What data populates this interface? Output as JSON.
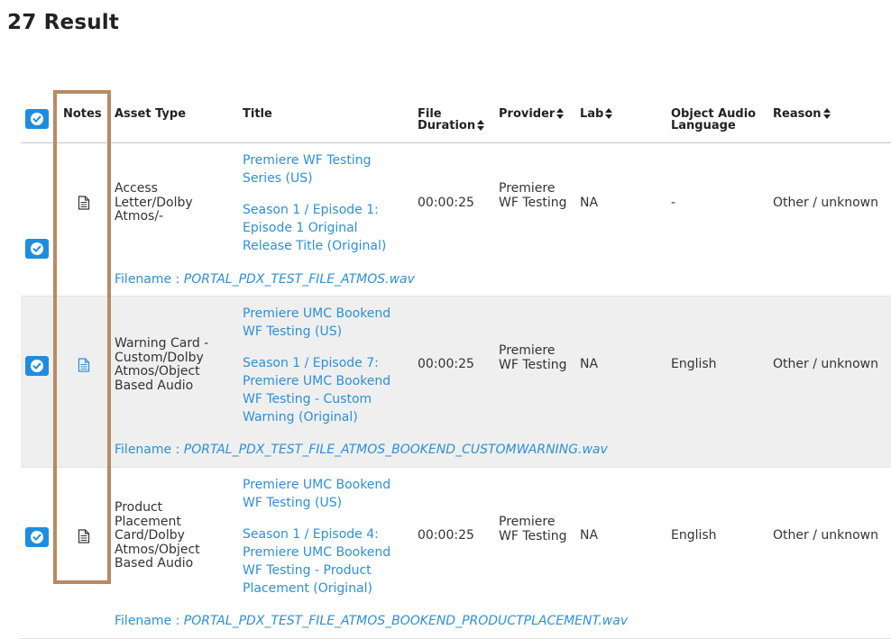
{
  "page": {
    "result_title": "27 Result"
  },
  "header": {
    "notes": "Notes",
    "asset_type": "Asset Type",
    "title": "Title",
    "file_duration_line1": "File",
    "file_duration_line2": "Duration",
    "provider": "Provider",
    "lab": "Lab",
    "object_audio_language_line1": "Object Audio",
    "object_audio_language_line2": "Language",
    "reason": "Reason"
  },
  "rows": [
    {
      "asset_type": "Access Letter/Dolby Atmos/-",
      "series_title": "Premiere WF Testing Series (US)",
      "episode_title": "Season 1 / Episode 1: Episode 1 Original Release Title (Original)",
      "duration": "00:00:25",
      "provider": "Premiere WF Testing",
      "lab": "NA",
      "object_audio_language": "-",
      "reason": "Other / unknown",
      "filename_label": "Filename :",
      "filename": "PORTAL_PDX_TEST_FILE_ATMOS.wav",
      "note_icon_color": "#333333"
    },
    {
      "asset_type": "Warning Card - Custom/Dolby Atmos/Object Based Audio",
      "series_title": "Premiere UMC Bookend WF Testing (US)",
      "episode_title": "Season 1 / Episode 7: Premiere UMC Bookend WF Testing - Custom Warning (Original)",
      "duration": "00:00:25",
      "provider": "Premiere WF Testing",
      "lab": "NA",
      "object_audio_language": "English",
      "reason": "Other / unknown",
      "filename_label": "Filename :",
      "filename": "PORTAL_PDX_TEST_FILE_ATMOS_BOOKEND_CUSTOMWARNING.wav",
      "note_icon_color": "#2f8fd6"
    },
    {
      "asset_type": "Product Placement Card/Dolby Atmos/Object Based Audio",
      "series_title": "Premiere UMC Bookend WF Testing (US)",
      "episode_title": "Season 1 / Episode 4: Premiere UMC Bookend WF Testing - Product Placement (Original)",
      "duration": "00:00:25",
      "provider": "Premiere WF Testing",
      "lab": "NA",
      "object_audio_language": "English",
      "reason": "Other / unknown",
      "filename_label": "Filename :",
      "filename": "PORTAL_PDX_TEST_FILE_ATMOS_BOOKEND_PRODUCTPLACEMENT.wav",
      "note_icon_color": "#333333"
    }
  ],
  "colors": {
    "accent": "#1d8de0",
    "link": "#2f8fd6",
    "highlight_border": "#b88a64",
    "alt_row_bg": "#efefef"
  }
}
